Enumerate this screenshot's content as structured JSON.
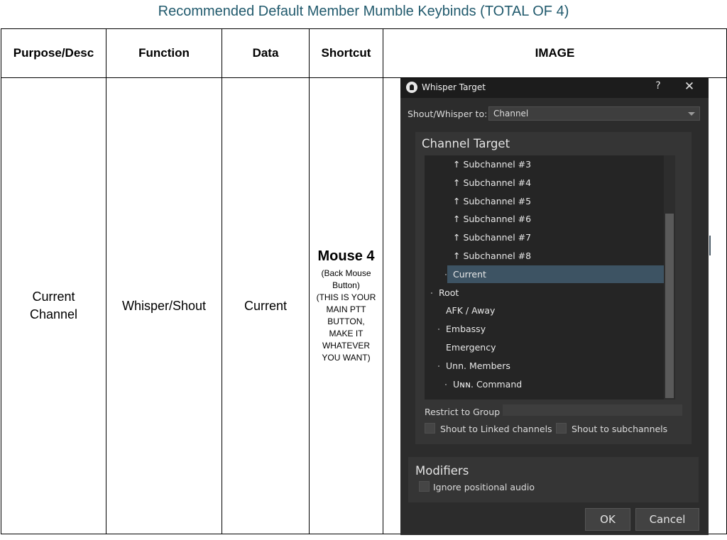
{
  "document": {
    "title": "Recommended Default Member Mumble Keybinds (TOTAL OF 4)"
  },
  "table": {
    "headers": [
      "Purpose/Desc",
      "Function",
      "Data",
      "Shortcut",
      "IMAGE"
    ],
    "row": {
      "purpose_line1": "Current",
      "purpose_line2": "Channel",
      "function": "Whisper/Shout",
      "data": "Current",
      "shortcut_main": "Mouse 4",
      "shortcut_note_lines": [
        "(Back Mouse",
        "Button)",
        "(THIS IS YOUR",
        "MAIN PTT",
        "BUTTON,",
        "MAKE IT",
        "WHATEVER",
        "YOU WANT)"
      ]
    }
  },
  "dialog": {
    "title": "Whisper Target",
    "help_label": "?",
    "close_label": "✕",
    "app_icon": "mumble-headset-icon",
    "shout_whisper_label": "Shout/Whisper to:",
    "shout_whisper_value": "Channel",
    "channel_target": {
      "title": "Channel Target",
      "tree": [
        {
          "label": "↑ Subchannel #3",
          "depth": 3,
          "selected": false,
          "dot": false
        },
        {
          "label": "↑ Subchannel #4",
          "depth": 3,
          "selected": false,
          "dot": false
        },
        {
          "label": "↑ Subchannel #5",
          "depth": 3,
          "selected": false,
          "dot": false
        },
        {
          "label": "↑ Subchannel #6",
          "depth": 3,
          "selected": false,
          "dot": false
        },
        {
          "label": "↑ Subchannel #7",
          "depth": 3,
          "selected": false,
          "dot": false
        },
        {
          "label": "↑ Subchannel #8",
          "depth": 3,
          "selected": false,
          "dot": false
        },
        {
          "label": "Current",
          "depth": 2,
          "selected": true,
          "dot": true
        },
        {
          "label": "Root",
          "depth": 0,
          "selected": false,
          "dot": true
        },
        {
          "label": "AFK / Away",
          "depth": 1,
          "selected": false,
          "dot": false
        },
        {
          "label": "Embassy",
          "depth": 1,
          "selected": false,
          "dot": true
        },
        {
          "label": "Emergency",
          "depth": 1,
          "selected": false,
          "dot": false
        },
        {
          "label": "Unn. Members",
          "depth": 1,
          "selected": false,
          "dot": true
        },
        {
          "label": "Uɴɴ. Command",
          "depth": 2,
          "selected": false,
          "dot": true
        }
      ],
      "restrict_label": "Restrict to Group",
      "restrict_value": "",
      "shout_linked_label": "Shout to Linked channels",
      "shout_sub_label": "Shout to subchannels"
    },
    "modifiers": {
      "title": "Modifiers",
      "ignore_positional_label": "Ignore positional audio"
    },
    "ok_label": "OK",
    "cancel_label": "Cancel"
  },
  "colors": {
    "title_text": "#215a6d",
    "dialog_bg": "#2c2c2c",
    "selected_row": "#3d5363"
  }
}
